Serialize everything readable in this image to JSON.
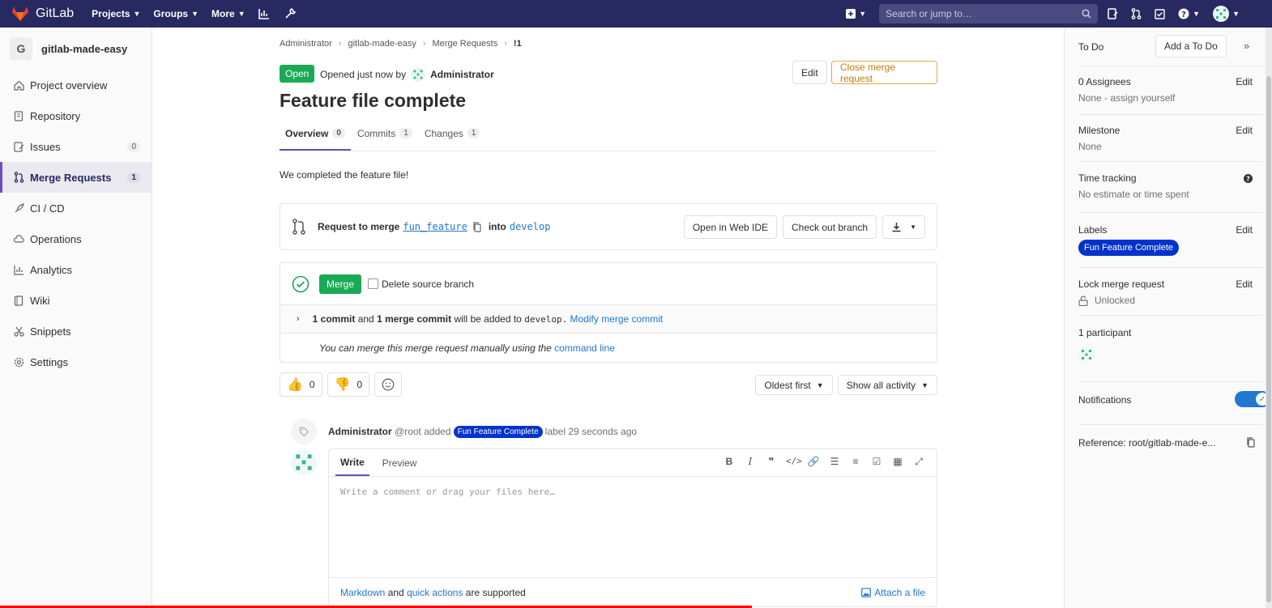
{
  "app": {
    "name": "GitLab"
  },
  "topnav": {
    "links": [
      {
        "label": "Projects"
      },
      {
        "label": "Groups"
      },
      {
        "label": "More"
      }
    ],
    "search_placeholder": "Search or jump to…"
  },
  "project": {
    "initial": "G",
    "name": "gitlab-made-easy"
  },
  "sidebar": {
    "items": [
      {
        "label": "Project overview",
        "icon": "home-icon"
      },
      {
        "label": "Repository",
        "icon": "book-icon"
      },
      {
        "label": "Issues",
        "icon": "issues-icon",
        "count": "0"
      },
      {
        "label": "Merge Requests",
        "icon": "merge-request-icon",
        "count": "1",
        "active": true
      },
      {
        "label": "CI / CD",
        "icon": "rocket-icon"
      },
      {
        "label": "Operations",
        "icon": "cloud-gear-icon"
      },
      {
        "label": "Analytics",
        "icon": "chart-icon"
      },
      {
        "label": "Wiki",
        "icon": "book-icon"
      },
      {
        "label": "Snippets",
        "icon": "scissors-icon"
      },
      {
        "label": "Settings",
        "icon": "gear-icon"
      }
    ]
  },
  "breadcrumb": [
    "Administrator",
    "gitlab-made-easy",
    "Merge Requests",
    "!1"
  ],
  "mr": {
    "status": "Open",
    "opened_text": "Opened just now by",
    "author": "Administrator",
    "edit_label": "Edit",
    "close_label": "Close merge request",
    "title": "Feature file complete",
    "tabs": [
      {
        "label": "Overview",
        "count": "0"
      },
      {
        "label": "Commits",
        "count": "1"
      },
      {
        "label": "Changes",
        "count": "1"
      }
    ],
    "description": "We completed the feature file!"
  },
  "widget": {
    "request_label": "Request to merge",
    "source_branch": "fun_feature",
    "into_label": "into",
    "target_branch": "develop",
    "web_ide_label": "Open in Web IDE",
    "checkout_label": "Check out branch",
    "merge_label": "Merge",
    "delete_source_label": "Delete source branch",
    "commit_count": "1 commit",
    "and_text": "and",
    "merge_commit": "1 merge commit",
    "will_be_added": "will be added to",
    "target_mono": "develop.",
    "modify_label": "Modify merge commit",
    "manual_text": "You can merge this merge request manually using the",
    "command_line": "command line"
  },
  "awards": {
    "thumbsup": "0",
    "thumbsdown": "0"
  },
  "filters": {
    "sort": "Oldest first",
    "activity": "Show all activity"
  },
  "note": {
    "author": "Administrator",
    "handle": "@root",
    "added": "added",
    "label": "Fun Feature Complete",
    "suffix": "label 29 seconds ago"
  },
  "comment": {
    "write_tab": "Write",
    "preview_tab": "Preview",
    "placeholder": "Write a comment or drag your files here…",
    "markdown": "Markdown",
    "and": "and",
    "quick_actions": "quick actions",
    "supported": "are supported",
    "attach": "Attach a file"
  },
  "right_sidebar": {
    "todo_title": "To Do",
    "add_todo": "Add a To Do",
    "assignees_title": "0 Assignees",
    "assignees_value": "None - assign yourself",
    "milestone_title": "Milestone",
    "milestone_value": "None",
    "time_title": "Time tracking",
    "time_value": "No estimate or time spent",
    "labels_title": "Labels",
    "label_value": "Fun Feature Complete",
    "lock_title": "Lock merge request",
    "lock_value": "Unlocked",
    "participants_title": "1 participant",
    "notifications_title": "Notifications",
    "reference": "Reference: root/gitlab-made-e...",
    "edit_label": "Edit"
  },
  "colors": {
    "nav": "#292961",
    "accent": "#6b4fbb",
    "success": "#1aaa55",
    "link": "#1f78d1",
    "label": "#0033cc",
    "warning": "#c17d10"
  }
}
